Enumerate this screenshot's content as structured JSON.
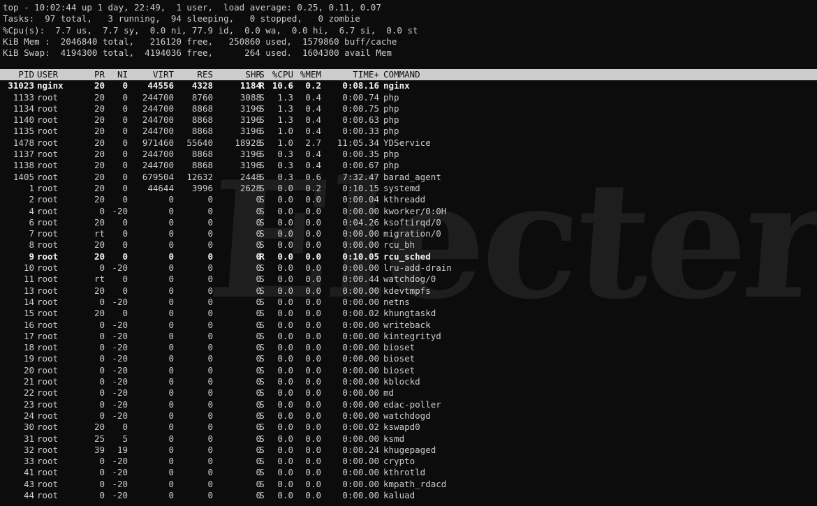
{
  "summary": {
    "line1": "top - 10:02:44 up 1 day, 22:49,  1 user,  load average: 0.25, 0.11, 0.07",
    "line2": "Tasks:  97 total,   3 running,  94 sleeping,   0 stopped,   0 zombie",
    "line3": "%Cpu(s):  7.7 us,  7.7 sy,  0.0 ni, 77.9 id,  0.0 wa,  0.0 hi,  6.7 si,  0.0 st",
    "line4": "KiB Mem :  2046840 total,   216120 free,   250860 used,  1579860 buff/cache",
    "line5": "KiB Swap:  4194300 total,  4194036 free,      264 used.  1604300 avail Mem"
  },
  "watermark": "Electerm",
  "columns": {
    "pid": "PID",
    "user": "USER",
    "pr": "PR",
    "ni": "NI",
    "virt": "VIRT",
    "res": "RES",
    "shr": "SHR",
    "s": "S",
    "cpu": "%CPU",
    "mem": "%MEM",
    "time": "TIME+",
    "command": "COMMAND"
  },
  "processes": [
    {
      "pid": "31023",
      "user": "nginx",
      "pr": "20",
      "ni": "0",
      "virt": "44556",
      "res": "4328",
      "shr": "1184",
      "s": "R",
      "cpu": "10.6",
      "mem": "0.2",
      "time": "0:08.16",
      "command": "nginx"
    },
    {
      "pid": "1133",
      "user": "root",
      "pr": "20",
      "ni": "0",
      "virt": "244700",
      "res": "8760",
      "shr": "3088",
      "s": "S",
      "cpu": "1.3",
      "mem": "0.4",
      "time": "0:00.74",
      "command": "php"
    },
    {
      "pid": "1134",
      "user": "root",
      "pr": "20",
      "ni": "0",
      "virt": "244700",
      "res": "8868",
      "shr": "3196",
      "s": "S",
      "cpu": "1.3",
      "mem": "0.4",
      "time": "0:00.75",
      "command": "php"
    },
    {
      "pid": "1140",
      "user": "root",
      "pr": "20",
      "ni": "0",
      "virt": "244700",
      "res": "8868",
      "shr": "3196",
      "s": "S",
      "cpu": "1.3",
      "mem": "0.4",
      "time": "0:00.63",
      "command": "php"
    },
    {
      "pid": "1135",
      "user": "root",
      "pr": "20",
      "ni": "0",
      "virt": "244700",
      "res": "8868",
      "shr": "3196",
      "s": "S",
      "cpu": "1.0",
      "mem": "0.4",
      "time": "0:00.33",
      "command": "php"
    },
    {
      "pid": "1478",
      "user": "root",
      "pr": "20",
      "ni": "0",
      "virt": "971460",
      "res": "55640",
      "shr": "18928",
      "s": "S",
      "cpu": "1.0",
      "mem": "2.7",
      "time": "11:05.34",
      "command": "YDService"
    },
    {
      "pid": "1137",
      "user": "root",
      "pr": "20",
      "ni": "0",
      "virt": "244700",
      "res": "8868",
      "shr": "3196",
      "s": "S",
      "cpu": "0.3",
      "mem": "0.4",
      "time": "0:00.35",
      "command": "php"
    },
    {
      "pid": "1138",
      "user": "root",
      "pr": "20",
      "ni": "0",
      "virt": "244700",
      "res": "8868",
      "shr": "3196",
      "s": "S",
      "cpu": "0.3",
      "mem": "0.4",
      "time": "0:00.67",
      "command": "php"
    },
    {
      "pid": "1405",
      "user": "root",
      "pr": "20",
      "ni": "0",
      "virt": "679504",
      "res": "12632",
      "shr": "2448",
      "s": "S",
      "cpu": "0.3",
      "mem": "0.6",
      "time": "7:32.47",
      "command": "barad_agent"
    },
    {
      "pid": "1",
      "user": "root",
      "pr": "20",
      "ni": "0",
      "virt": "44644",
      "res": "3996",
      "shr": "2628",
      "s": "S",
      "cpu": "0.0",
      "mem": "0.2",
      "time": "0:10.15",
      "command": "systemd"
    },
    {
      "pid": "2",
      "user": "root",
      "pr": "20",
      "ni": "0",
      "virt": "0",
      "res": "0",
      "shr": "0",
      "s": "S",
      "cpu": "0.0",
      "mem": "0.0",
      "time": "0:00.04",
      "command": "kthreadd"
    },
    {
      "pid": "4",
      "user": "root",
      "pr": "0",
      "ni": "-20",
      "virt": "0",
      "res": "0",
      "shr": "0",
      "s": "S",
      "cpu": "0.0",
      "mem": "0.0",
      "time": "0:00.00",
      "command": "kworker/0:0H"
    },
    {
      "pid": "6",
      "user": "root",
      "pr": "20",
      "ni": "0",
      "virt": "0",
      "res": "0",
      "shr": "0",
      "s": "S",
      "cpu": "0.0",
      "mem": "0.0",
      "time": "0:04.26",
      "command": "ksoftirqd/0"
    },
    {
      "pid": "7",
      "user": "root",
      "pr": "rt",
      "ni": "0",
      "virt": "0",
      "res": "0",
      "shr": "0",
      "s": "S",
      "cpu": "0.0",
      "mem": "0.0",
      "time": "0:00.00",
      "command": "migration/0"
    },
    {
      "pid": "8",
      "user": "root",
      "pr": "20",
      "ni": "0",
      "virt": "0",
      "res": "0",
      "shr": "0",
      "s": "S",
      "cpu": "0.0",
      "mem": "0.0",
      "time": "0:00.00",
      "command": "rcu_bh"
    },
    {
      "pid": "9",
      "user": "root",
      "pr": "20",
      "ni": "0",
      "virt": "0",
      "res": "0",
      "shr": "0",
      "s": "R",
      "cpu": "0.0",
      "mem": "0.0",
      "time": "0:10.05",
      "command": "rcu_sched"
    },
    {
      "pid": "10",
      "user": "root",
      "pr": "0",
      "ni": "-20",
      "virt": "0",
      "res": "0",
      "shr": "0",
      "s": "S",
      "cpu": "0.0",
      "mem": "0.0",
      "time": "0:00.00",
      "command": "lru-add-drain"
    },
    {
      "pid": "11",
      "user": "root",
      "pr": "rt",
      "ni": "0",
      "virt": "0",
      "res": "0",
      "shr": "0",
      "s": "S",
      "cpu": "0.0",
      "mem": "0.0",
      "time": "0:00.44",
      "command": "watchdog/0"
    },
    {
      "pid": "13",
      "user": "root",
      "pr": "20",
      "ni": "0",
      "virt": "0",
      "res": "0",
      "shr": "0",
      "s": "S",
      "cpu": "0.0",
      "mem": "0.0",
      "time": "0:00.00",
      "command": "kdevtmpfs"
    },
    {
      "pid": "14",
      "user": "root",
      "pr": "0",
      "ni": "-20",
      "virt": "0",
      "res": "0",
      "shr": "0",
      "s": "S",
      "cpu": "0.0",
      "mem": "0.0",
      "time": "0:00.00",
      "command": "netns"
    },
    {
      "pid": "15",
      "user": "root",
      "pr": "20",
      "ni": "0",
      "virt": "0",
      "res": "0",
      "shr": "0",
      "s": "S",
      "cpu": "0.0",
      "mem": "0.0",
      "time": "0:00.02",
      "command": "khungtaskd"
    },
    {
      "pid": "16",
      "user": "root",
      "pr": "0",
      "ni": "-20",
      "virt": "0",
      "res": "0",
      "shr": "0",
      "s": "S",
      "cpu": "0.0",
      "mem": "0.0",
      "time": "0:00.00",
      "command": "writeback"
    },
    {
      "pid": "17",
      "user": "root",
      "pr": "0",
      "ni": "-20",
      "virt": "0",
      "res": "0",
      "shr": "0",
      "s": "S",
      "cpu": "0.0",
      "mem": "0.0",
      "time": "0:00.00",
      "command": "kintegrityd"
    },
    {
      "pid": "18",
      "user": "root",
      "pr": "0",
      "ni": "-20",
      "virt": "0",
      "res": "0",
      "shr": "0",
      "s": "S",
      "cpu": "0.0",
      "mem": "0.0",
      "time": "0:00.00",
      "command": "bioset"
    },
    {
      "pid": "19",
      "user": "root",
      "pr": "0",
      "ni": "-20",
      "virt": "0",
      "res": "0",
      "shr": "0",
      "s": "S",
      "cpu": "0.0",
      "mem": "0.0",
      "time": "0:00.00",
      "command": "bioset"
    },
    {
      "pid": "20",
      "user": "root",
      "pr": "0",
      "ni": "-20",
      "virt": "0",
      "res": "0",
      "shr": "0",
      "s": "S",
      "cpu": "0.0",
      "mem": "0.0",
      "time": "0:00.00",
      "command": "bioset"
    },
    {
      "pid": "21",
      "user": "root",
      "pr": "0",
      "ni": "-20",
      "virt": "0",
      "res": "0",
      "shr": "0",
      "s": "S",
      "cpu": "0.0",
      "mem": "0.0",
      "time": "0:00.00",
      "command": "kblockd"
    },
    {
      "pid": "22",
      "user": "root",
      "pr": "0",
      "ni": "-20",
      "virt": "0",
      "res": "0",
      "shr": "0",
      "s": "S",
      "cpu": "0.0",
      "mem": "0.0",
      "time": "0:00.00",
      "command": "md"
    },
    {
      "pid": "23",
      "user": "root",
      "pr": "0",
      "ni": "-20",
      "virt": "0",
      "res": "0",
      "shr": "0",
      "s": "S",
      "cpu": "0.0",
      "mem": "0.0",
      "time": "0:00.00",
      "command": "edac-poller"
    },
    {
      "pid": "24",
      "user": "root",
      "pr": "0",
      "ni": "-20",
      "virt": "0",
      "res": "0",
      "shr": "0",
      "s": "S",
      "cpu": "0.0",
      "mem": "0.0",
      "time": "0:00.00",
      "command": "watchdogd"
    },
    {
      "pid": "30",
      "user": "root",
      "pr": "20",
      "ni": "0",
      "virt": "0",
      "res": "0",
      "shr": "0",
      "s": "S",
      "cpu": "0.0",
      "mem": "0.0",
      "time": "0:00.02",
      "command": "kswapd0"
    },
    {
      "pid": "31",
      "user": "root",
      "pr": "25",
      "ni": "5",
      "virt": "0",
      "res": "0",
      "shr": "0",
      "s": "S",
      "cpu": "0.0",
      "mem": "0.0",
      "time": "0:00.00",
      "command": "ksmd"
    },
    {
      "pid": "32",
      "user": "root",
      "pr": "39",
      "ni": "19",
      "virt": "0",
      "res": "0",
      "shr": "0",
      "s": "S",
      "cpu": "0.0",
      "mem": "0.0",
      "time": "0:00.24",
      "command": "khugepaged"
    },
    {
      "pid": "33",
      "user": "root",
      "pr": "0",
      "ni": "-20",
      "virt": "0",
      "res": "0",
      "shr": "0",
      "s": "S",
      "cpu": "0.0",
      "mem": "0.0",
      "time": "0:00.00",
      "command": "crypto"
    },
    {
      "pid": "41",
      "user": "root",
      "pr": "0",
      "ni": "-20",
      "virt": "0",
      "res": "0",
      "shr": "0",
      "s": "S",
      "cpu": "0.0",
      "mem": "0.0",
      "time": "0:00.00",
      "command": "kthrotld"
    },
    {
      "pid": "43",
      "user": "root",
      "pr": "0",
      "ni": "-20",
      "virt": "0",
      "res": "0",
      "shr": "0",
      "s": "S",
      "cpu": "0.0",
      "mem": "0.0",
      "time": "0:00.00",
      "command": "kmpath_rdacd"
    },
    {
      "pid": "44",
      "user": "root",
      "pr": "0",
      "ni": "-20",
      "virt": "0",
      "res": "0",
      "shr": "0",
      "s": "S",
      "cpu": "0.0",
      "mem": "0.0",
      "time": "0:00.00",
      "command": "kaluad"
    }
  ],
  "colors": {
    "background": "#0c0c0c",
    "foreground": "#cccccc",
    "header_background": "#cccccc",
    "header_foreground": "#0c0c0c"
  }
}
